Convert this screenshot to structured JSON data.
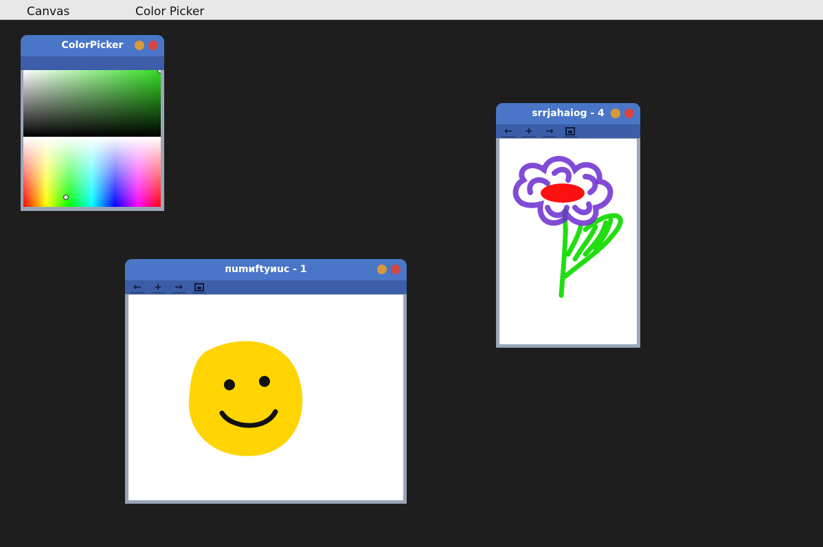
{
  "menubar": {
    "items": [
      "Canvas",
      "Color Picker"
    ]
  },
  "color_picker": {
    "title": "ColorPicker",
    "selected_hue_color": "#33dd22"
  },
  "windows": [
    {
      "title": "пumиftyиuc - 1",
      "drawing": "smiley face",
      "colors": {
        "face": "#ffd400",
        "features": "#111111"
      }
    },
    {
      "title": "srrjahaiog - 4",
      "drawing": "flower",
      "colors": {
        "petals": "#7a2ad8",
        "center": "#ff1010",
        "stem": "#22dd11"
      }
    }
  ],
  "toolbar": {
    "back_icon": "←",
    "add_icon": "+",
    "forward_icon": "→",
    "save_icon": "save-icon"
  },
  "theme": {
    "titlebar": "#4a76c8",
    "toolbar": "#3c5ea8",
    "desktop": "#1e1e1e",
    "minimize": "#d99a3c",
    "close": "#d64545"
  }
}
